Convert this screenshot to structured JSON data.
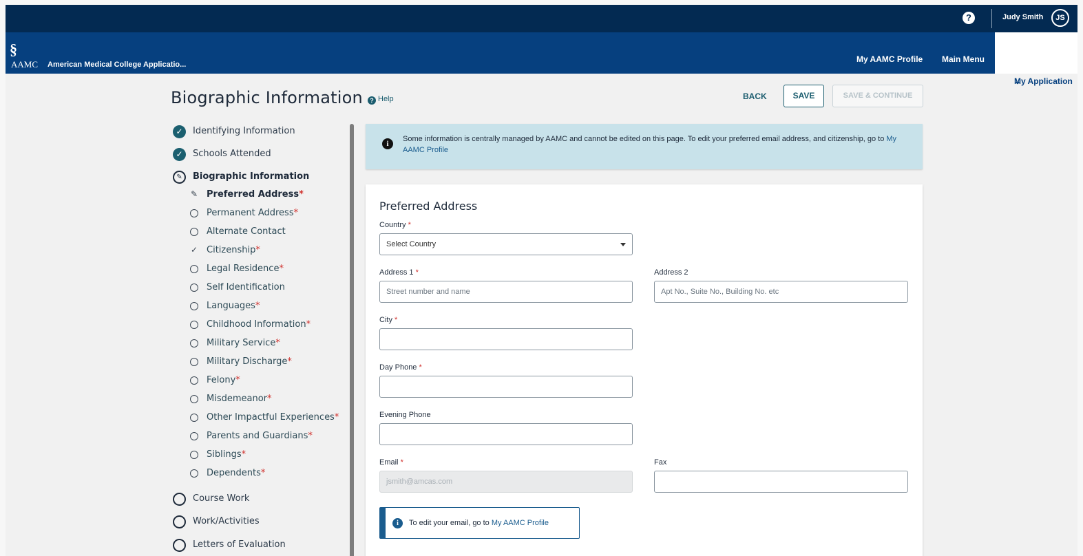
{
  "topbar": {
    "help_icon": "question-icon",
    "user_name": "Judy Smith",
    "user_initials": "JS"
  },
  "navbar": {
    "logo_mark": "§",
    "logo_text": "AAMC",
    "app_title": "American Medical College Applicatio...",
    "links": [
      "My AAMC Profile",
      "Main Menu"
    ],
    "active_link": "My Application",
    "active_chevron": "⌄"
  },
  "header": {
    "title": "Biographic Information",
    "help_label": "Help",
    "back_label": "BACK",
    "save_label": "SAVE",
    "save_continue_label": "SAVE & CONTINUE"
  },
  "sidebar": {
    "sections": [
      {
        "label": "Identifying Information",
        "status": "complete"
      },
      {
        "label": "Schools Attended",
        "status": "complete"
      },
      {
        "label": "Biographic Information",
        "status": "in-progress"
      },
      {
        "label": "Course Work",
        "status": "not-started"
      },
      {
        "label": "Work/Activities",
        "status": "not-started"
      },
      {
        "label": "Letters of Evaluation",
        "status": "not-started"
      }
    ],
    "subitems": [
      {
        "label": "Preferred Address",
        "required": "*",
        "status": "editing"
      },
      {
        "label": "Permanent Address",
        "required": "*",
        "status": "open"
      },
      {
        "label": "Alternate Contact",
        "required": "",
        "status": "open"
      },
      {
        "label": "Citizenship",
        "required": "*",
        "status": "complete"
      },
      {
        "label": "Legal Residence",
        "required": "*",
        "status": "open"
      },
      {
        "label": "Self Identification",
        "required": "",
        "status": "open"
      },
      {
        "label": "Languages",
        "required": "*",
        "status": "open"
      },
      {
        "label": "Childhood Information",
        "required": "*",
        "status": "open"
      },
      {
        "label": "Military Service",
        "required": "*",
        "status": "open"
      },
      {
        "label": "Military Discharge",
        "required": "*",
        "status": "open"
      },
      {
        "label": "Felony",
        "required": "*",
        "status": "open"
      },
      {
        "label": "Misdemeanor",
        "required": "*",
        "status": "open"
      },
      {
        "label": "Other Impactful Experiences",
        "required": "*",
        "status": "open"
      },
      {
        "label": "Parents and Guardians",
        "required": "*",
        "status": "open"
      },
      {
        "label": "Siblings",
        "required": "*",
        "status": "open"
      },
      {
        "label": "Dependents",
        "required": "*",
        "status": "open"
      }
    ]
  },
  "banner": {
    "text": "Some information is centrally managed by AAMC and cannot be edited on this page. To edit your preferred email address, and citizenship, go to ",
    "link": "My AAMC Profile"
  },
  "form": {
    "title": "Preferred Address",
    "required_mark": "*",
    "country_label": "Country",
    "country_value": "Select Country",
    "address1_label": "Address 1",
    "address1_placeholder": "Street number and name",
    "address2_label": "Address 2",
    "address2_placeholder": "Apt No., Suite No., Building No. etc",
    "city_label": "City",
    "city_value": "",
    "day_phone_label": "Day Phone",
    "day_phone_value": "",
    "evening_phone_label": "Evening Phone",
    "evening_phone_value": "",
    "email_label": "Email",
    "email_value": "jsmith@amcas.com",
    "fax_label": "Fax",
    "fax_value": "",
    "email_note_text": "To edit your email, go to ",
    "email_note_link": "My AAMC Profile"
  }
}
